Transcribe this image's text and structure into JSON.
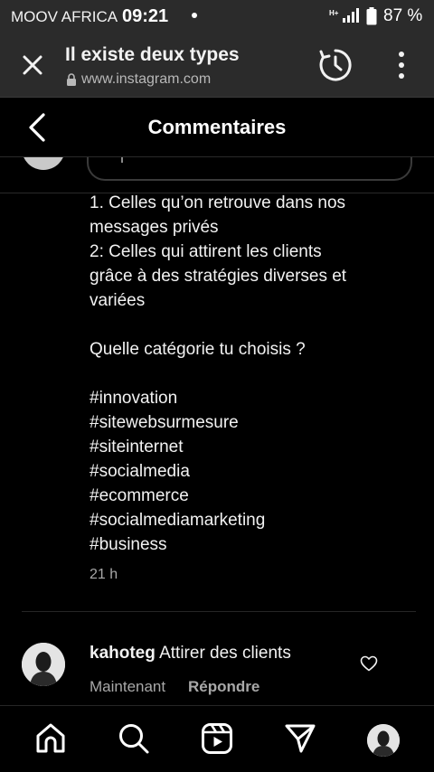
{
  "status_bar": {
    "carrier": "MOOV AFRICA",
    "time": "09:21",
    "network": "H+",
    "battery": "87 %",
    "icons": [
      "notification-dot",
      "signal-icon",
      "battery-icon"
    ]
  },
  "browser": {
    "page_title": "Il existe deux types",
    "url": "www.instagram.com",
    "icons": [
      "close-icon",
      "lock-icon",
      "history-icon",
      "more-vert-icon"
    ]
  },
  "header": {
    "title": "Commentaires",
    "icons": [
      "back-arrow-icon"
    ]
  },
  "caption": {
    "lines": [
      "1. Celles qu’on retrouve dans nos",
      "messages privés",
      "2: Celles qui attirent les clients",
      "grâce à des stratégies diverses et",
      "variées",
      "",
      "Quelle catégorie tu choisis ?",
      "",
      "#innovation",
      "#sitewebsurmesure",
      "#siteinternet",
      "#socialmedia",
      "#ecommerce",
      "#socialmediamarketing",
      "#business"
    ],
    "time": "21 h"
  },
  "comment": {
    "username": "kahoteg",
    "text": "Attirer des clients",
    "time": "Maintenant",
    "reply_label": "Répondre",
    "icons": [
      "heart-icon",
      "avatar"
    ]
  },
  "bottom_nav": {
    "items": [
      "home-icon",
      "search-icon",
      "reels-icon",
      "direct-icon",
      "profile-avatar"
    ]
  },
  "colors": {
    "background": "#000000",
    "chrome_bar": "#2b2b2b",
    "text_primary": "#f2f2f2",
    "text_secondary": "#a8a8a8"
  }
}
